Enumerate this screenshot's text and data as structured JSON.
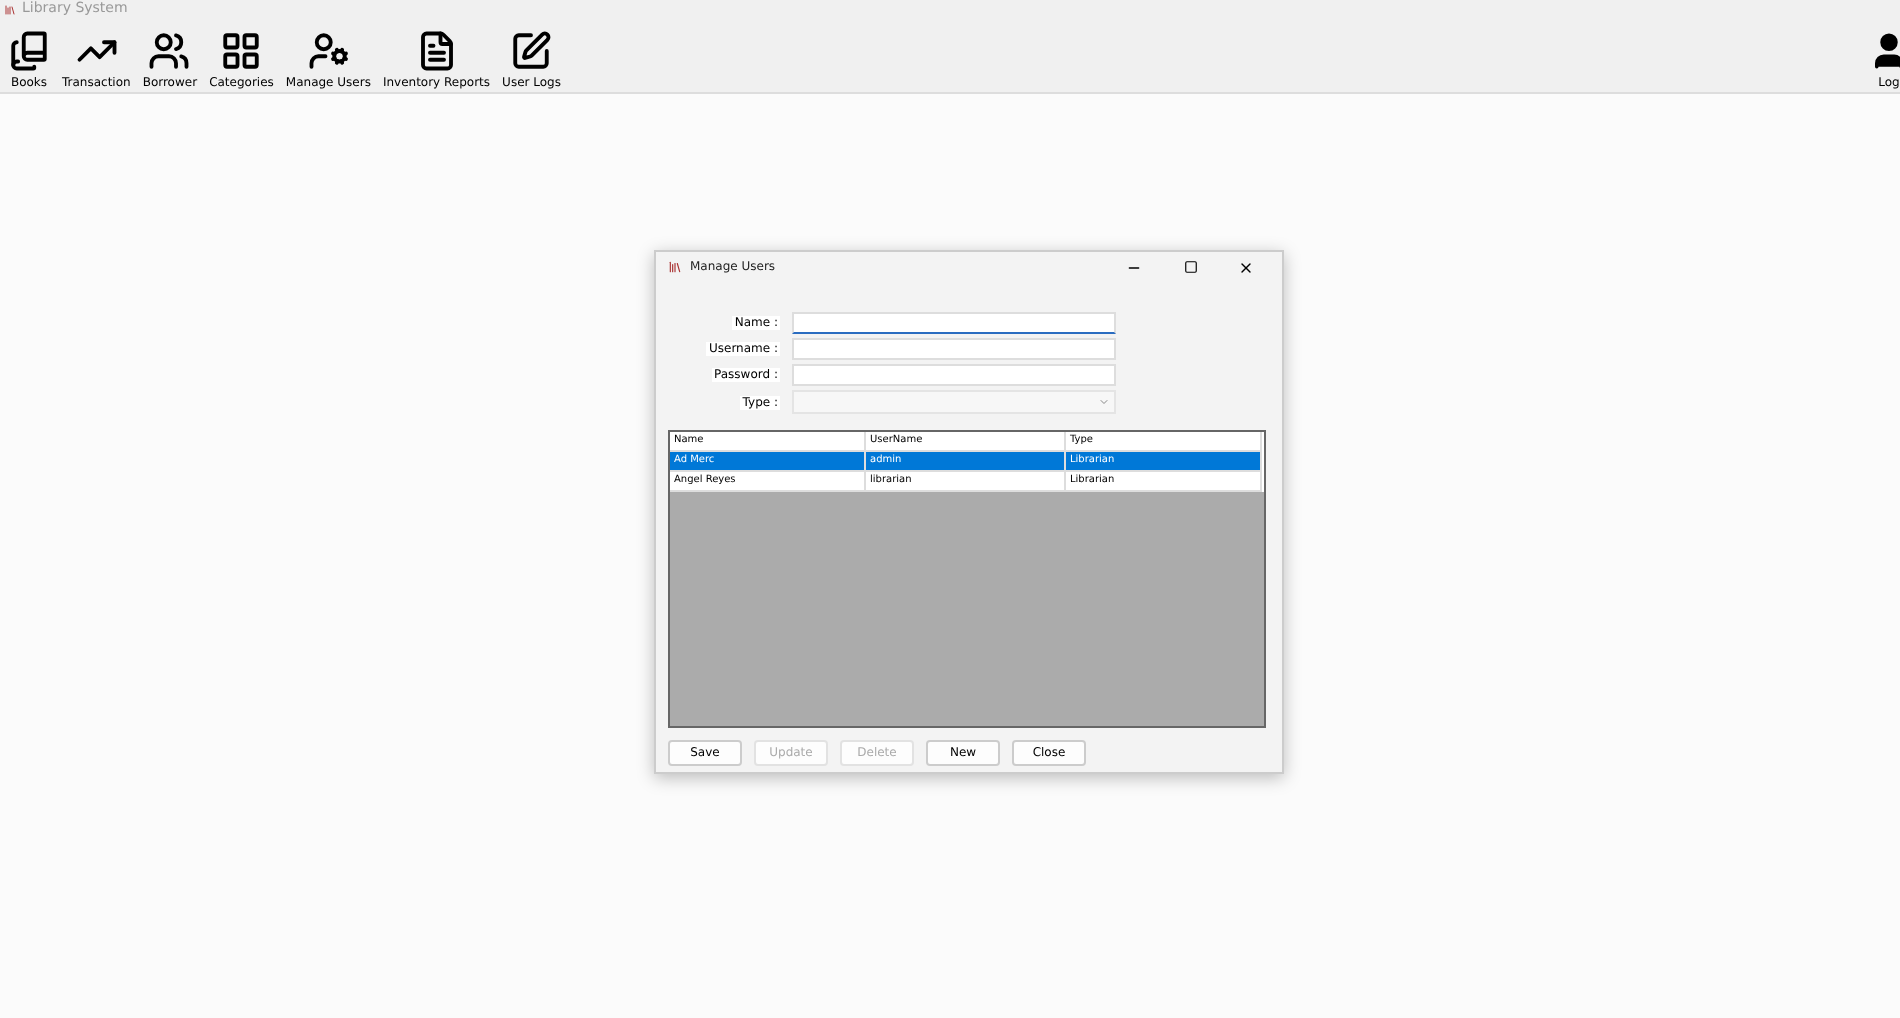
{
  "window": {
    "title": "Library System"
  },
  "toolbar": [
    {
      "label": "Books"
    },
    {
      "label": "Transaction"
    },
    {
      "label": "Borrower"
    },
    {
      "label": "Categories"
    },
    {
      "label": "Manage Users"
    },
    {
      "label": "Inventory Reports"
    },
    {
      "label": "User Logs"
    }
  ],
  "logout": {
    "label": "Log"
  },
  "dialog": {
    "title": "Manage Users",
    "fields": [
      {
        "label": "Name :",
        "kind": "text",
        "focused": true
      },
      {
        "label": "Username :",
        "kind": "text",
        "focused": false
      },
      {
        "label": "Password :",
        "kind": "text",
        "focused": false
      },
      {
        "label": "Type :",
        "kind": "select",
        "focused": false
      }
    ],
    "table": {
      "columns": [
        "Name",
        "UserName",
        "Type"
      ],
      "rows": [
        {
          "cells": [
            "Ad Merc",
            "admin",
            "Librarian"
          ],
          "selected": true
        },
        {
          "cells": [
            "Angel Reyes",
            "librarian",
            "Librarian"
          ],
          "selected": false
        }
      ]
    },
    "buttons": [
      {
        "label": "Save",
        "disabled": false
      },
      {
        "label": "Update",
        "disabled": true
      },
      {
        "label": "Delete",
        "disabled": true
      },
      {
        "label": "New",
        "disabled": false
      },
      {
        "label": "Close",
        "disabled": false
      }
    ]
  }
}
